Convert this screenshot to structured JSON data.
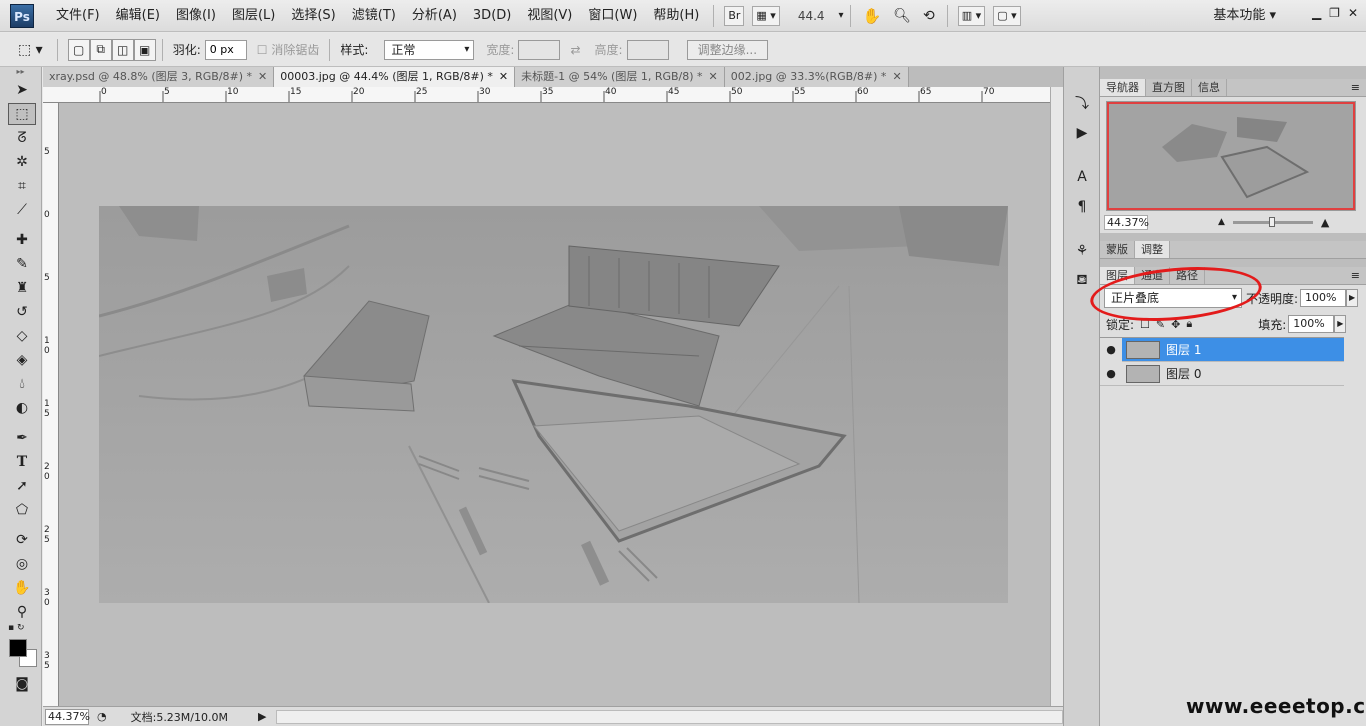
{
  "app": {
    "logo": "Ps",
    "workspace": "基本功能",
    "zoom_display": "44.4"
  },
  "menu": [
    "文件(F)",
    "编辑(E)",
    "图像(I)",
    "图层(L)",
    "选择(S)",
    "滤镜(T)",
    "分析(A)",
    "3D(D)",
    "视图(V)",
    "窗口(W)",
    "帮助(H)"
  ],
  "menubar_buttons": {
    "bridge": "Br"
  },
  "options": {
    "feather_label": "羽化:",
    "feather_value": "0 px",
    "antialias_label": "消除锯齿",
    "style_label": "样式:",
    "style_value": "正常",
    "width_label": "宽度:",
    "height_label": "高度:",
    "refine_edge": "调整边缘..."
  },
  "tabs": [
    {
      "label": "xray.psd @ 48.8% (图层 3, RGB/8#) *",
      "active": false
    },
    {
      "label": "00003.jpg @ 44.4% (图层 1, RGB/8#) *",
      "active": true
    },
    {
      "label": "未标题-1 @ 54% (图层 1, RGB/8) *",
      "active": false
    },
    {
      "label": "002.jpg @ 33.3%(RGB/8#) *",
      "active": false
    }
  ],
  "ruler_h": [
    "0",
    "5",
    "10",
    "15",
    "20",
    "25",
    "30",
    "35",
    "40",
    "45",
    "50",
    "55",
    "60",
    "65",
    "70"
  ],
  "ruler_v": [
    "5",
    "0",
    "5",
    "1 0",
    "1 5",
    "2 0",
    "2 5",
    "3 0",
    "3 5"
  ],
  "status": {
    "zoom": "44.37%",
    "doc": "文档:5.23M/10.0M"
  },
  "navigator": {
    "tabs": [
      "导航器",
      "直方图",
      "信息"
    ],
    "zoom": "44.37%"
  },
  "adjust_tabs": [
    "蒙版",
    "调整"
  ],
  "layers": {
    "tabs": [
      "图层",
      "通道",
      "路径"
    ],
    "blend_mode": "正片叠底",
    "opacity_label": "不透明度:",
    "opacity": "100%",
    "lock_label": "锁定:",
    "fill_label": "填充:",
    "fill": "100%",
    "items": [
      {
        "name": "图层 1",
        "selected": true
      },
      {
        "name": "图层 0",
        "selected": false
      }
    ]
  },
  "watermark": "www.eeeetop.com",
  "colors": {
    "selection": "#3d8fe6",
    "annotation": "#e31b1b"
  }
}
